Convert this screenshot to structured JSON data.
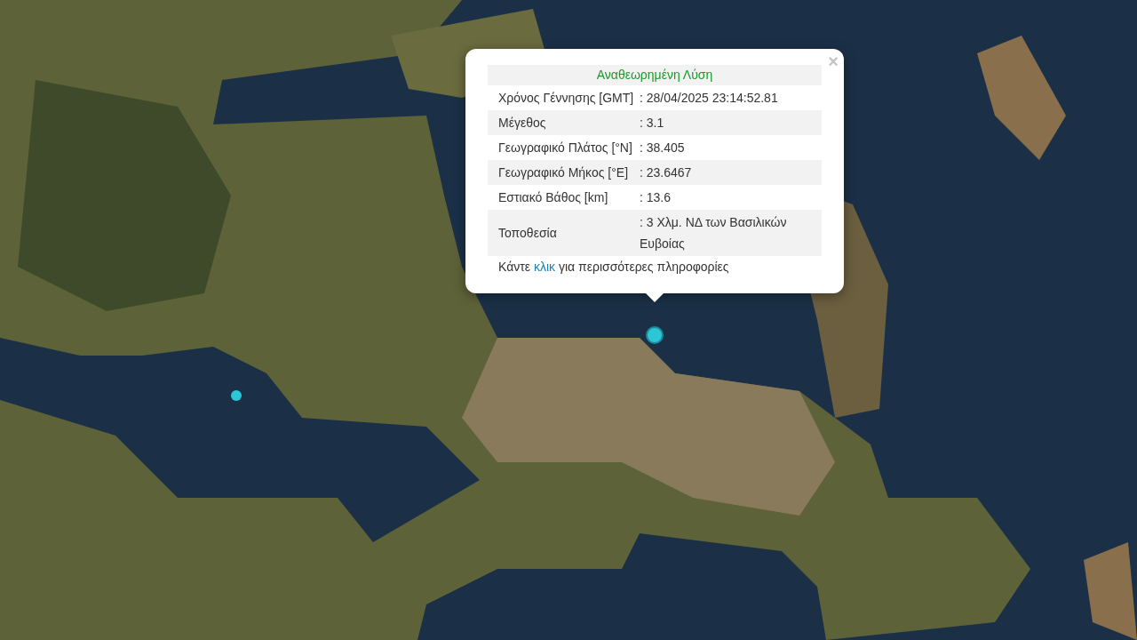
{
  "popup": {
    "title": "Αναθεωρημένη Λύση",
    "close": "×",
    "rows": [
      {
        "label": "Χρόνος Γέννησης [GMT]",
        "value": ": 28/04/2025 23:14:52.81"
      },
      {
        "label": "Μέγεθος",
        "value": ": 3.1"
      },
      {
        "label": "Γεωγραφικό Πλάτος [°N]",
        "value": ": 38.405"
      },
      {
        "label": "Γεωγραφικό Μήκος [°E]",
        "value": ": 23.6467"
      },
      {
        "label": "Εστιακό Βάθος [km]",
        "value": ": 13.6"
      },
      {
        "label": "Τοποθεσία",
        "value": ": 3 Χλμ. ΝΔ των Βασιλικών Ευβοίας"
      }
    ],
    "footer": {
      "before": "Κάντε ",
      "link": "κλικ",
      "after": " για περισσότερες πληροφορίες"
    }
  },
  "markers": [
    {
      "selected": true
    },
    {
      "selected": false
    }
  ]
}
